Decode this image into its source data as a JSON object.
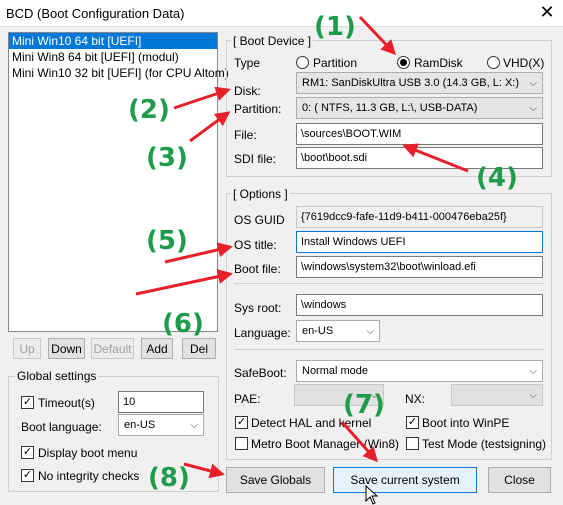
{
  "window": {
    "title": "BCD (Boot Configuration Data)",
    "close_glyph": "✕"
  },
  "entries": [
    {
      "label": "Mini Win10 64 bit [UEFI]",
      "selected": true
    },
    {
      "label": "Mini Win8 64 bit  [UEFI] (modul)",
      "selected": false
    },
    {
      "label": "Mini Win10 32 bit [UEFI] (for CPU Altom)",
      "selected": false
    }
  ],
  "list_buttons": {
    "up": "Up",
    "down": "Down",
    "default": "Default",
    "add": "Add",
    "del": "Del"
  },
  "global_settings": {
    "title": "Global settings",
    "timeout_label": "Timeout(s)",
    "timeout_checked": true,
    "timeout_value": "10",
    "boot_language_label": "Boot language:",
    "boot_language_value": "en-US",
    "display_menu_label": "Display boot menu",
    "display_menu_checked": true,
    "no_integrity_label": "No integrity checks",
    "no_integrity_checked": true
  },
  "boot_device": {
    "title": "[ Boot Device ]",
    "type_label": "Type",
    "type_options": [
      {
        "label": "Partition",
        "selected": false
      },
      {
        "label": "RamDisk",
        "selected": true
      },
      {
        "label": "VHD(X)",
        "selected": false
      }
    ],
    "disk_label": "Disk:",
    "disk_value": "RM1: SanDiskUltra USB 3.0 (14.3 GB, L: X:)",
    "partition_label": "Partition:",
    "partition_value": "0: ( NTFS,  11.3 GB, L:\\, USB-DATA)",
    "file_label": "File:",
    "file_value": "\\sources\\BOOT.WIM",
    "sdi_label": "SDI file:",
    "sdi_value": "\\boot\\boot.sdi"
  },
  "options": {
    "title": "[ Options ]",
    "guid_label": "OS GUID",
    "guid_value": "{7619dcc9-fafe-11d9-b411-000476eba25f}",
    "os_title_label": "OS title:",
    "os_title_value": "Install Windows UEFI",
    "boot_file_label": "Boot file:",
    "boot_file_value": "\\windows\\system32\\boot\\winload.efi",
    "sys_root_label": "Sys root:",
    "sys_root_value": "\\windows",
    "language_label": "Language:",
    "language_value": "en-US",
    "safeboot_label": "SafeBoot:",
    "safeboot_value": "Normal mode",
    "pae_label": "PAE:",
    "nx_label": "NX:",
    "detect_hal_label": "Detect HAL and kernel",
    "detect_hal_checked": true,
    "winpe_label": "Boot into WinPE",
    "winpe_checked": true,
    "metro_label": "Metro Boot Manager (Win8)",
    "metro_checked": false,
    "testmode_label": "Test Mode (testsigning)",
    "testmode_checked": false
  },
  "bottom_buttons": {
    "save_globals": "Save Globals",
    "save_current": "Save current system",
    "close": "Close"
  },
  "annotations": [
    "(1)",
    "(2)",
    "(3)",
    "(4)",
    "(5)",
    "(6)",
    "(7)",
    "(8)"
  ],
  "colors": {
    "accent": "#0078d7",
    "annotation_green": "#1e9c4c",
    "arrow_red": "#e8202a"
  }
}
